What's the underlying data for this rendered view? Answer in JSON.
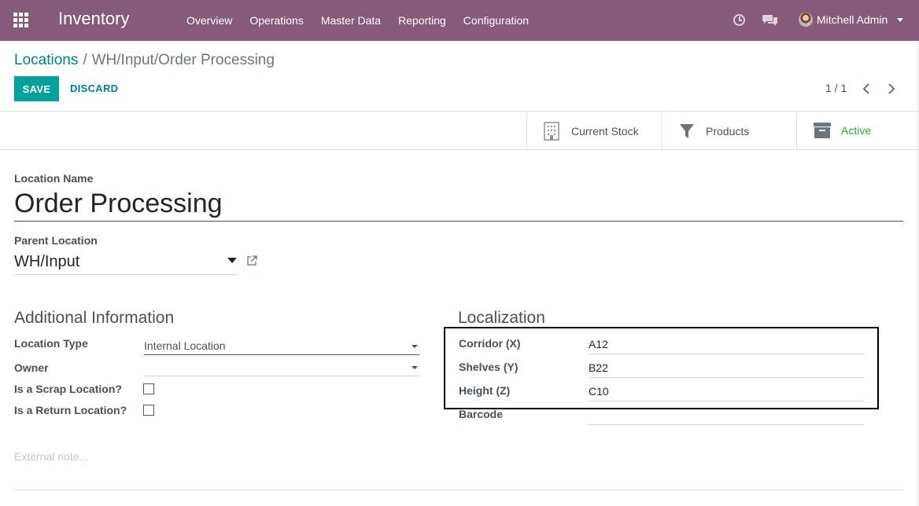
{
  "navbar": {
    "brand": "Inventory",
    "menu": [
      "Overview",
      "Operations",
      "Master Data",
      "Reporting",
      "Configuration"
    ],
    "user_name": "Mitchell Admin",
    "icons": [
      "apps-grid-icon",
      "clock-icon",
      "chat-icon",
      "avatar"
    ],
    "colors": {
      "bar": "#875a7b",
      "text": "#ffffff"
    }
  },
  "breadcrumb": {
    "parent": "Locations",
    "separator": "/",
    "current": "WH/Input/Order Processing"
  },
  "actions": {
    "save": "SAVE",
    "discard": "DISCARD"
  },
  "pager": {
    "value": "1 / 1"
  },
  "stat_buttons": [
    {
      "label": "Current Stock",
      "icon": "building-icon"
    },
    {
      "label": "Products",
      "icon": "filter-icon"
    },
    {
      "label": "Active",
      "icon": "archive-icon",
      "color": "#28a745"
    }
  ],
  "form": {
    "name_label": "Location Name",
    "name_value": "Order Processing",
    "parent_label": "Parent Location",
    "parent_value": "WH/Input",
    "additional": {
      "title": "Additional Information",
      "location_type_label": "Location Type",
      "location_type_value": "Internal Location",
      "owner_label": "Owner",
      "owner_value": "",
      "scrap_label": "Is a Scrap Location?",
      "scrap_checked": false,
      "return_label": "Is a Return Location?",
      "return_checked": false
    },
    "localization": {
      "title": "Localization",
      "corridor_label": "Corridor (X)",
      "corridor_value": "A12",
      "shelves_label": "Shelves (Y)",
      "shelves_value": "B22",
      "height_label": "Height (Z)",
      "height_value": "C10",
      "barcode_label": "Barcode",
      "barcode_value": ""
    },
    "note_placeholder": "External note..."
  },
  "colors": {
    "accent": "#00a09d",
    "link": "#017e84",
    "active": "#28a745"
  }
}
